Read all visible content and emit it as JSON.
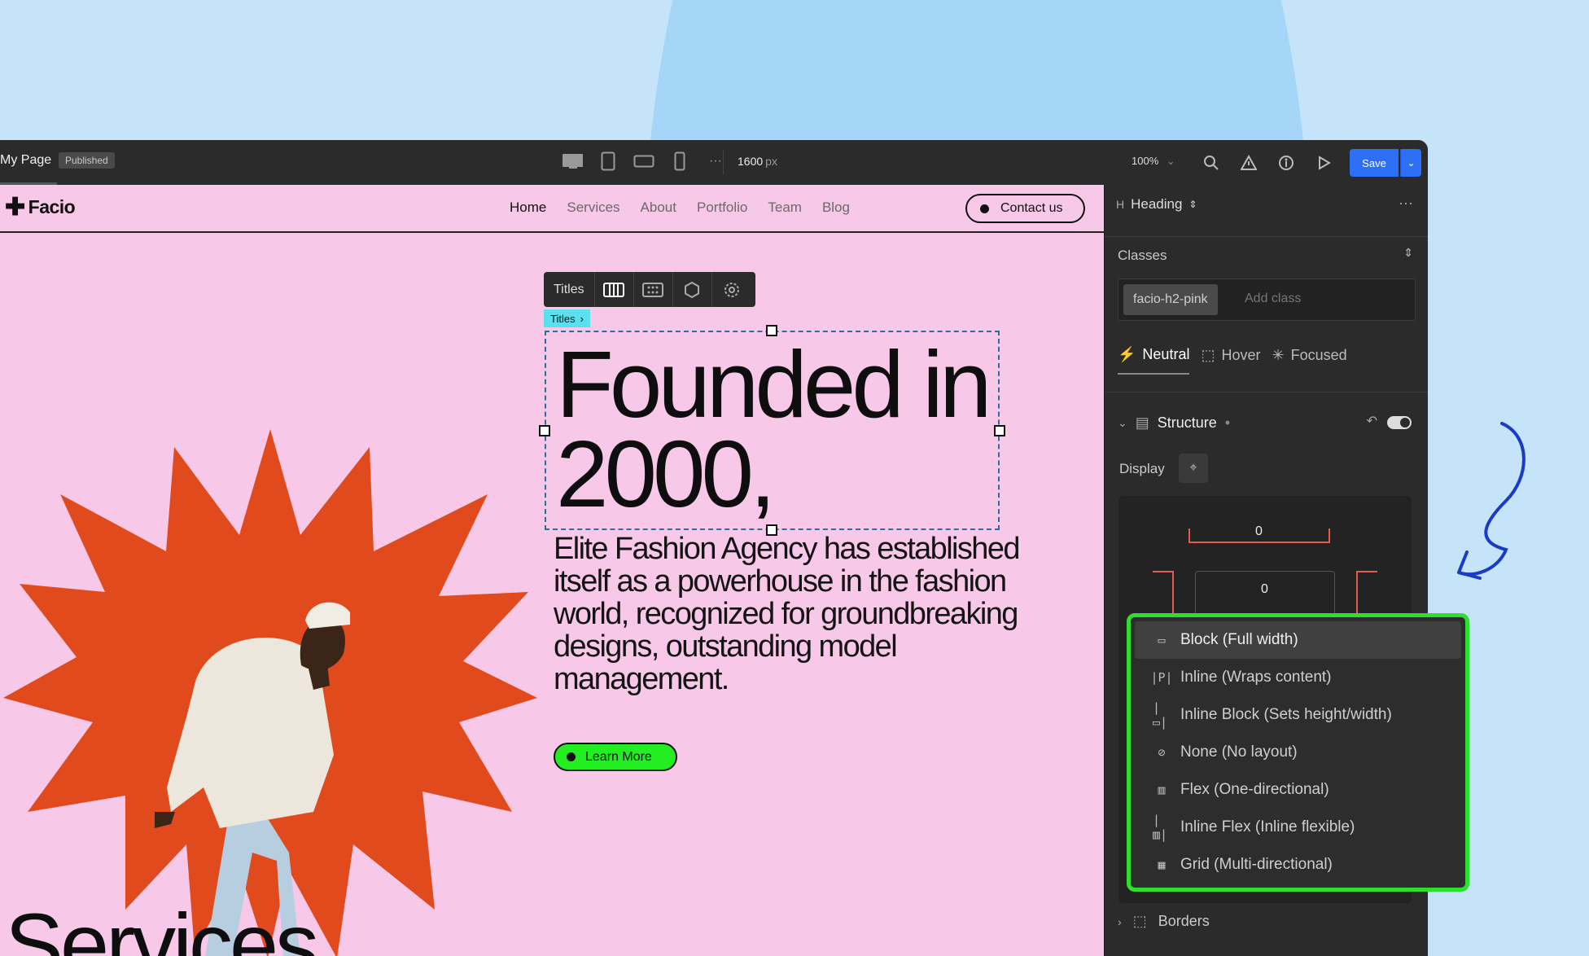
{
  "topbar": {
    "page_name": "My Page",
    "status_badge": "Published",
    "canvas_width": "1600",
    "canvas_unit": "px",
    "zoom": "100%",
    "save_label": "Save"
  },
  "site": {
    "logo": "Facio",
    "nav": [
      "Home",
      "Services",
      "About",
      "Portfolio",
      "Team",
      "Blog"
    ],
    "contact_label": "Contact us",
    "toolbar_label": "Titles",
    "breadcrumb": "Titles",
    "headline": "Founded in 2000,",
    "paragraph": "Elite Fashion Agency has established itself as a powerhouse in the fashion world, recognized for groundbreaking designs, outstanding model management.",
    "learn_more": "Learn More",
    "services_heading": "Services"
  },
  "panel": {
    "element_type": "Heading",
    "classes_label": "Classes",
    "class_name": "facio-h2-pink",
    "add_class_placeholder": "Add class",
    "states": [
      "Neutral",
      "Hover",
      "Focused"
    ],
    "structure_label": "Structure",
    "display_label": "Display",
    "margin_top": "0",
    "padding_top": "0",
    "borders_label": "Borders"
  },
  "display_menu": {
    "items": [
      {
        "icon": "block-icon",
        "glyph": "▭",
        "label": "Block (Full width)",
        "active": true
      },
      {
        "icon": "inline-icon",
        "glyph": "|P|",
        "label": "Inline (Wraps content)",
        "active": false
      },
      {
        "icon": "inline-block-icon",
        "glyph": "|▭|",
        "label": "Inline Block (Sets height/width)",
        "active": false
      },
      {
        "icon": "none-icon",
        "glyph": "⊘",
        "label": "None (No layout)",
        "active": false
      },
      {
        "icon": "flex-icon",
        "glyph": "▥",
        "label": "Flex (One-directional)",
        "active": false
      },
      {
        "icon": "inline-flex-icon",
        "glyph": "|▥|",
        "label": "Inline Flex (Inline flexible)",
        "active": false
      },
      {
        "icon": "grid-icon",
        "glyph": "▦",
        "label": "Grid (Multi-directional)",
        "active": false
      }
    ]
  },
  "colors": {
    "canvas_bg": "#f7c8e8",
    "star": "#e04a1c",
    "accent_green": "#2ee02e",
    "save_blue": "#2d6ff6",
    "squiggle": "#1a3cc4"
  }
}
